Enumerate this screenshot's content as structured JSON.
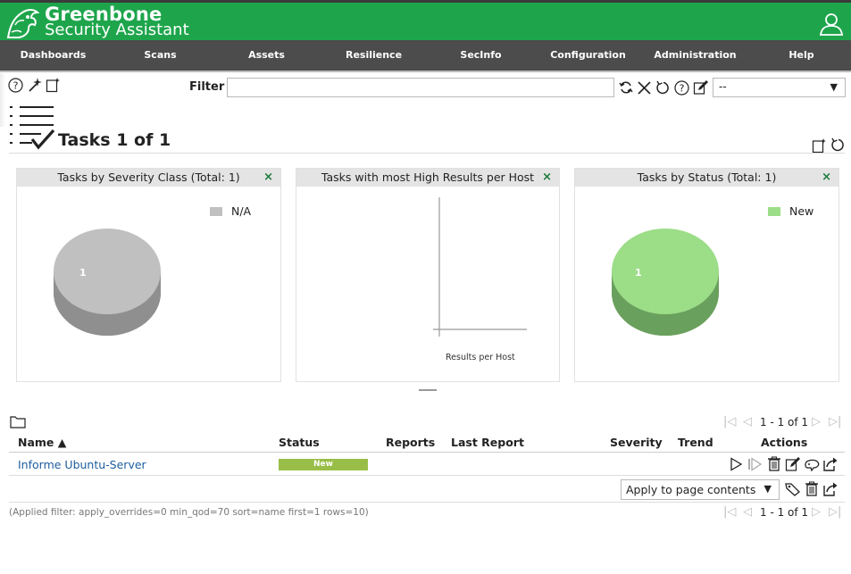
{
  "header": {
    "brand_line1": "Greenbone",
    "brand_line2": "Security Assistant"
  },
  "menu": [
    "Dashboards",
    "Scans",
    "Assets",
    "Resilience",
    "SecInfo",
    "Configuration",
    "Administration",
    "Help"
  ],
  "toolbar": {
    "filter_label": "Filter",
    "filter_value": "",
    "filter_select_value": "--"
  },
  "page": {
    "title": "Tasks 1 of 1"
  },
  "panels": [
    {
      "title": "Tasks by Severity Class (Total: 1)",
      "close": "×",
      "legend": "N/A",
      "slice_label": "1",
      "color": "#c0c0c0"
    },
    {
      "title": "Tasks with most High Results per Host",
      "close": "×",
      "axis_label": "Results per Host"
    },
    {
      "title": "Tasks by Status (Total: 1)",
      "close": "×",
      "legend": "New",
      "slice_label": "1",
      "color": "#9cdd88"
    }
  ],
  "table": {
    "headers": {
      "name": "Name ▲",
      "status": "Status",
      "reports": "Reports",
      "last_report": "Last Report",
      "severity": "Severity",
      "trend": "Trend",
      "actions": "Actions"
    },
    "rows": [
      {
        "name": "Informe Ubuntu-Server",
        "status": "New"
      }
    ],
    "pager_top": "1 - 1 of 1",
    "pager_bottom": "1 - 1 of 1",
    "apply_select": "Apply to page contents",
    "applied_filter": "(Applied filter: apply_overrides=0 min_qod=70 sort=name first=1 rows=10)"
  },
  "colors": {
    "header_green": "#1ea54c",
    "menu_gray": "#4c4c4c",
    "status_new": "#99be48",
    "link_blue": "#1d5d9e"
  }
}
